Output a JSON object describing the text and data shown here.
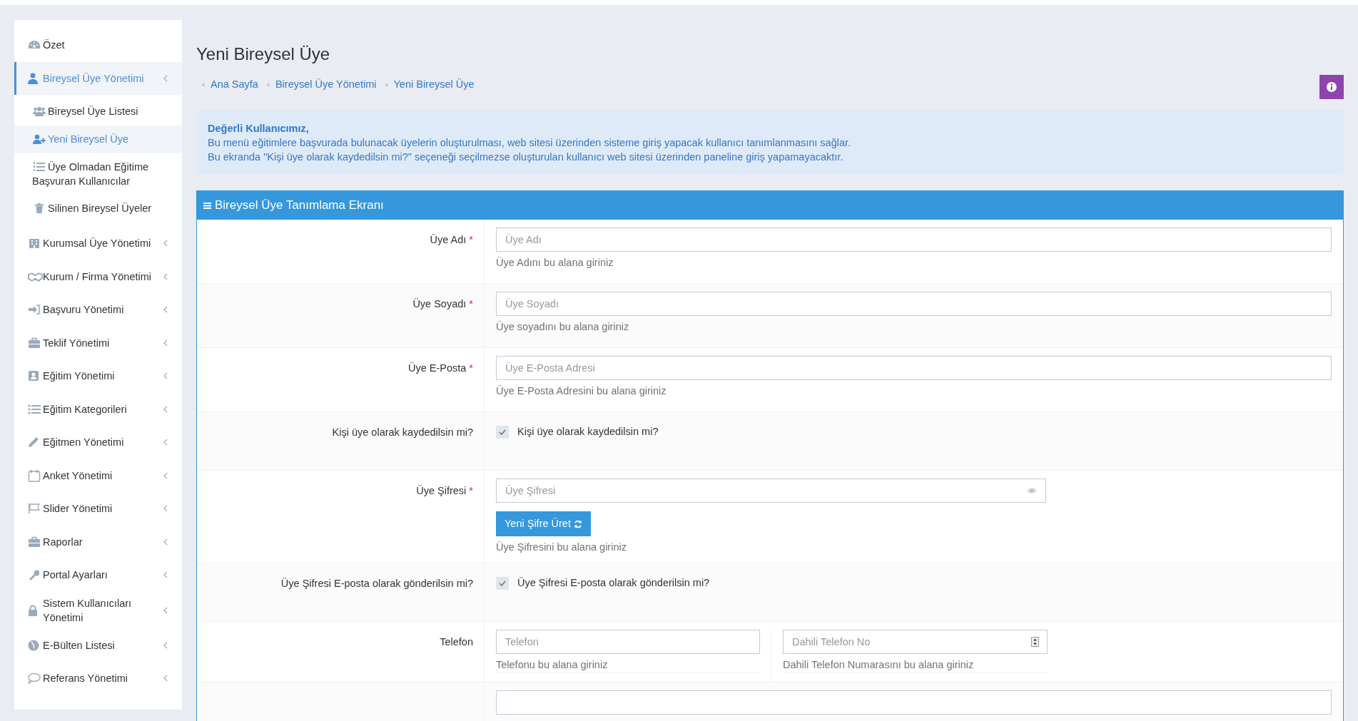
{
  "sidebar": {
    "items": [
      {
        "kind": "link",
        "label": "Özet",
        "selected": false
      },
      {
        "kind": "group",
        "label": "Bireysel Üye Yönetimi",
        "selected": true,
        "children": [
          {
            "label": "Bireysel Üye Listesi",
            "selected": false
          },
          {
            "label": "Yeni Bireysel Üye",
            "selected": true
          },
          {
            "label": "Üye Olmadan Eğitime Başvuran Kullanıcılar",
            "selected": false
          },
          {
            "label": "Silinen Bireysel Üyeler",
            "selected": false
          }
        ]
      },
      {
        "kind": "group",
        "label": "Kurumsal Üye Yönetimi",
        "selected": false
      },
      {
        "kind": "group",
        "label": "Kurum / Firma Yönetimi",
        "selected": false
      },
      {
        "kind": "group",
        "label": "Başvuru Yönetimi",
        "selected": false
      },
      {
        "kind": "group",
        "label": "Teklif Yönetimi",
        "selected": false
      },
      {
        "kind": "group",
        "label": "Eğitim Yönetimi",
        "selected": false
      },
      {
        "kind": "group",
        "label": "Eğitim Kategorileri",
        "selected": false
      },
      {
        "kind": "group",
        "label": "Eğitmen Yönetimi",
        "selected": false
      },
      {
        "kind": "group",
        "label": "Anket Yönetimi",
        "selected": false
      },
      {
        "kind": "group",
        "label": "Slider Yönetimi",
        "selected": false
      },
      {
        "kind": "group",
        "label": "Raporlar",
        "selected": false
      },
      {
        "kind": "group",
        "label": "Portal Ayarları",
        "selected": false
      },
      {
        "kind": "group",
        "label": "Sistem Kullanıcıları Yönetimi",
        "selected": false
      },
      {
        "kind": "group",
        "label": "E-Bülten Listesi",
        "selected": false
      },
      {
        "kind": "group",
        "label": "Referans Yönetimi",
        "selected": false
      }
    ]
  },
  "page_title": "Yeni Bireysel Üye",
  "breadcrumb": [
    "Ana Sayfa",
    "Bireysel Üye Yönetimi",
    "Yeni Bireysel Üye"
  ],
  "alert": {
    "title": "Değerli Kullanıcımız,",
    "lines": [
      "Bu menü eğitimlere başvurada bulunacak üyelerin oluşturulması, web sitesi üzerinden sisteme giriş yapacak kullanıcı tanımlanmasını sağlar.",
      "Bu ekranda \"Kişi üye olarak kaydedilsin mi?\" seçeneği seçilmezse oluşturulan kullanıcı web sitesi üzerinden paneline giriş yapamayacaktır."
    ]
  },
  "panel": {
    "title": "Bireysel Üye Tanımlama Ekranı",
    "rows": [
      {
        "kind": "text",
        "label": "Üye Adı",
        "required_mark": "*",
        "placeholder": "Üye Adı",
        "help": "Üye Adını bu alana giriniz"
      },
      {
        "kind": "text",
        "label": "Üye Soyadı",
        "required_mark": "*",
        "placeholder": "Üye Soyadı",
        "help": "Üye soyadını bu alana giriniz"
      },
      {
        "kind": "text",
        "label": "Üye E-Posta",
        "required_mark": "*",
        "placeholder": "Üye E-Posta Adresi",
        "help": "Üye E-Posta Adresini bu alana giriniz"
      },
      {
        "kind": "checkbox",
        "label": "Kişi üye olarak kaydedilsin mi?",
        "checked": true,
        "text": "Kişi üye olarak kaydedilsin mi?"
      },
      {
        "kind": "password",
        "label": "Üye Şifresi",
        "required_mark": "*",
        "placeholder": "Üye Şifresi",
        "button": "Yeni Şifre Üret",
        "help": "Üye Şifresini bu alana giriniz"
      },
      {
        "kind": "checkbox",
        "label": "Üye Şifresi E-posta olarak gönderilsin mi?",
        "checked": true,
        "text": "Üye Şifresi E-posta olarak gönderilsin mi?"
      },
      {
        "kind": "phone",
        "label": "Telefon",
        "placeholder": "Telefon",
        "help": "Telefonu bu alana giriniz",
        "extension_placeholder": "Dahili Telefon No",
        "extension_help": "Dahili Telefon Numarasını bu alana giriniz"
      },
      {
        "kind": "partial"
      }
    ]
  }
}
